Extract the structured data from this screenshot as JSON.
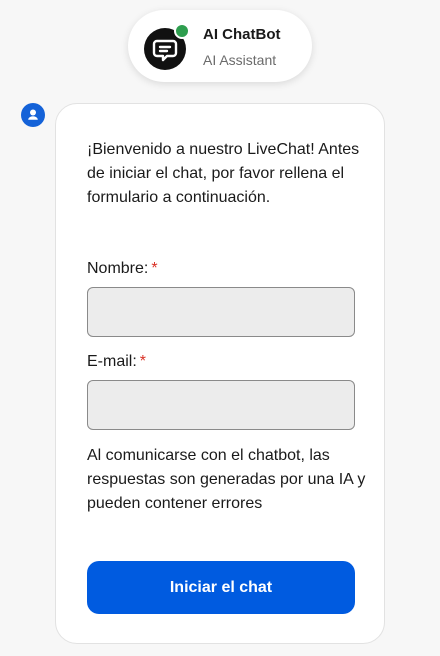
{
  "header": {
    "bot_name": "AI ChatBot",
    "bot_subtitle": "AI Assistant",
    "avatar_icon": "chat-bubble-icon",
    "status": "online",
    "status_color": "#2e9e4f"
  },
  "message": {
    "sender_icon": "user-icon",
    "welcome_text": "¡Bienvenido a nuestro LiveChat! Antes de iniciar el chat, por favor rellena el formulario a continuación.",
    "form": {
      "name_label": "Nombre:",
      "name_value": "",
      "email_label": "E-mail:",
      "email_value": "",
      "required_marker": "*"
    },
    "disclaimer": "Al comunicarse con el chatbot, las respuestas son generadas por una IA y pueden contener errores",
    "start_button": "Iniciar el chat"
  },
  "colors": {
    "accent": "#005be0",
    "required": "#d93025",
    "avatar_bg": "#111111"
  }
}
